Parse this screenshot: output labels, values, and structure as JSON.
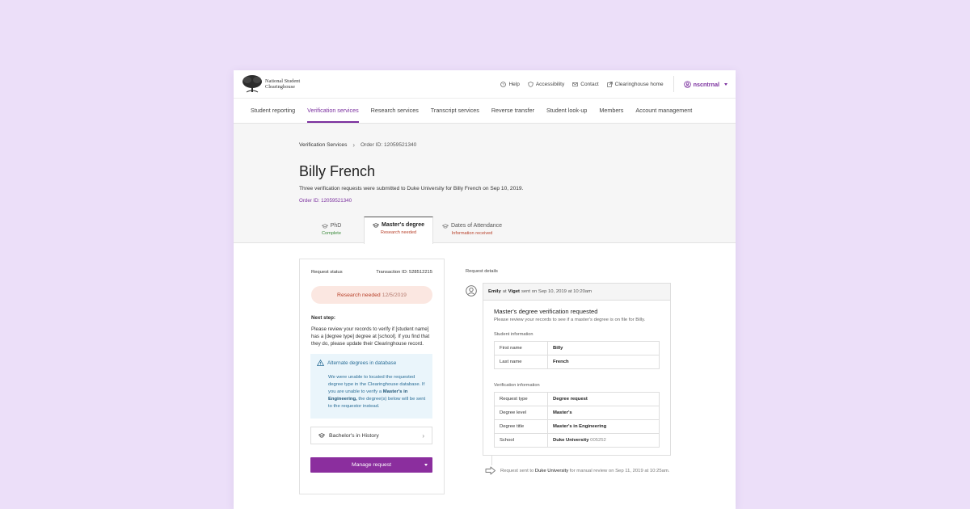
{
  "header": {
    "logo_line1": "National Student",
    "logo_line2": "Clearinghouse",
    "links": [
      {
        "label": "Help",
        "icon": "help-icon"
      },
      {
        "label": "Accessibility",
        "icon": "shield-icon"
      },
      {
        "label": "Contact",
        "icon": "mail-icon"
      },
      {
        "label": "Clearinghouse home",
        "icon": "external-link-icon"
      }
    ],
    "account": "nscntrnal"
  },
  "nav": {
    "items": [
      "Student reporting",
      "Verification services",
      "Research services",
      "Transcript services",
      "Reverse transfer",
      "Student look-up",
      "Members",
      "Account management"
    ],
    "active": "Verification services"
  },
  "breadcrumb": {
    "first": "Verification Services",
    "second": "Order ID: 12059521340"
  },
  "page": {
    "title": "Billy French",
    "subtitle": "Three verification requests were submitted to Duke University for Billy French on Sep 10, 2019.",
    "order_link": "Order ID: 12059521340"
  },
  "tabs": [
    {
      "label": "PhD",
      "status": "Complete"
    },
    {
      "label": "Master's degree",
      "status": "Research needed"
    },
    {
      "label": "Dates of Attendance",
      "status": "Information received"
    }
  ],
  "status_panel": {
    "label": "Request status",
    "transaction": "Transaction ID: 528512215",
    "pill_text": "Research needed",
    "pill_date": "12/5/2019",
    "next_step_title": "Next step:",
    "next_step_text": "Please review your records to verify if [student name] has a [degree type] degree at [school]. If you find that they do, please update their Clearinghouse record.",
    "alert_title": "Alternate degrees in database",
    "alert_text1": "We were unable to located the requested degree type in the Clearinghouse database. If you are unable to verify a",
    "alert_bold": "Master's in Engineering,",
    "alert_text2": "the degree(s) below will be sent to the requestor instead.",
    "alt_degree": "Bachelor's in History",
    "manage_button": "Manage request"
  },
  "request_details": {
    "label": "Request details",
    "sender_name": "Emily",
    "at_word": "at",
    "sender_org": "Viget",
    "sent_text": "sent on Sep 10, 2019 at 10:20am",
    "title": "Master's degree verification requested",
    "subtitle": "Please review your records to see if a master's degree is on file for Billy.",
    "student_section": "Student information",
    "student_rows": [
      {
        "key": "First name",
        "value": "Billy"
      },
      {
        "key": "Last name",
        "value": "French"
      }
    ],
    "verification_section": "Verification information",
    "verification_rows": [
      {
        "key": "Request type",
        "value": "Degree request"
      },
      {
        "key": "Degree level",
        "value": "Master's"
      },
      {
        "key": "Degree title",
        "value": "Master's in Engineering"
      },
      {
        "key": "School",
        "value": "Duke University",
        "extra": "005252"
      }
    ]
  },
  "timeline": {
    "prefix": "Request sent to",
    "school": "Duke University",
    "suffix": "for manual review on Sep 11, 2019 at 10:25am."
  },
  "colors": {
    "accent": "#7a2f9e",
    "button": "#8b2e9e",
    "alert_bg": "#eaf5fb",
    "pill_bg": "#fbe7e1",
    "page_bg": "#ecdff9"
  }
}
